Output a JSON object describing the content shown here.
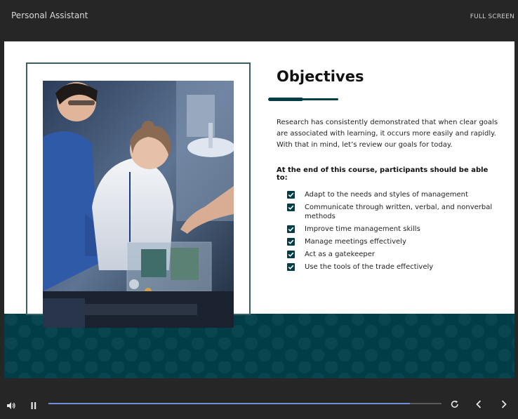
{
  "app": {
    "title": "Personal Assistant",
    "fullscreen_label": "FULL SCREEN"
  },
  "slide": {
    "heading": "Objectives",
    "intro": "Research has consistently demonstrated that when clear goals are associated with learning, it occurs more easily and rapidly. With that in mind, let’s review our goals for today.",
    "lead": "At the end of this course, participants should be able to:",
    "objectives": [
      "Adapt to the needs and styles of management",
      "Communicate through written, verbal, and nonverbal methods",
      "Improve time management skills",
      "Manage meetings effectively",
      "Act as a gatekeeper",
      "Use the tools of the trade effectively"
    ],
    "accent_color": "#003d47"
  },
  "player": {
    "progress": 0.92,
    "controls": [
      "volume-icon",
      "pause-icon",
      "replay-icon",
      "previous-icon",
      "next-icon"
    ]
  }
}
